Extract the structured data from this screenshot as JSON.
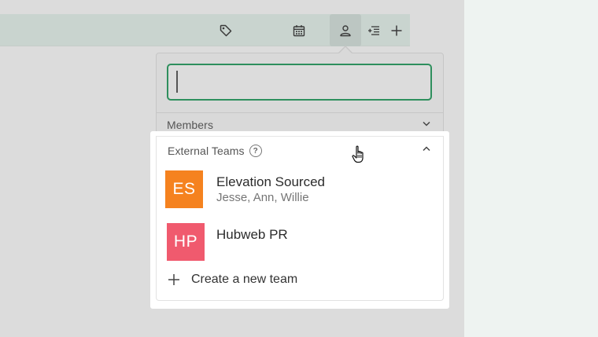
{
  "toolbar": {
    "icons": [
      "tag-icon",
      "calendar-icon",
      "person-icon",
      "sort-list-icon",
      "plus-icon"
    ]
  },
  "search": {
    "value": "",
    "placeholder": ""
  },
  "sections": {
    "members": {
      "label": "Members",
      "expanded": false
    },
    "external_teams": {
      "label": "External Teams",
      "expanded": true,
      "teams": [
        {
          "initials": "ES",
          "name": "Elevation Sourced",
          "members": "Jesse, Ann, Willie",
          "color": "#f5821f"
        },
        {
          "initials": "HP",
          "name": "Hubweb PR",
          "members": "",
          "color": "#f05a6e"
        }
      ],
      "create_label": "Create a new team"
    }
  },
  "colors": {
    "accent": "#2e8f5d",
    "toolbar_bg": "#c9d4cf",
    "side_panel_bg": "#eef3f1"
  }
}
